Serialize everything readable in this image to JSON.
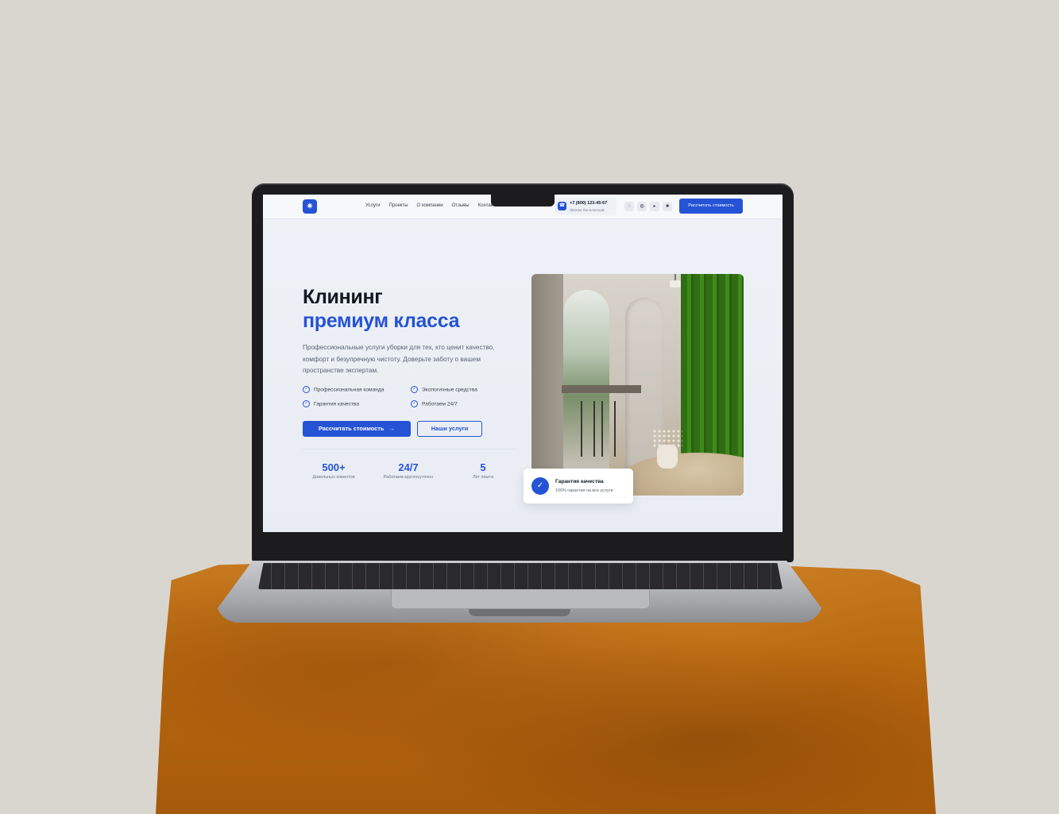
{
  "nav": {
    "logo_glyph": "✷",
    "menu": [
      "Услуги",
      "Проекты",
      "О компании",
      "Отзывы",
      "Контакты"
    ],
    "phone": "+7 (800) 123-45-67",
    "phone_note": "Звонок бесплатный",
    "phone_icon": "phone-icon",
    "socials": [
      "chat-icon",
      "discord-icon",
      "youtube-icon",
      "vk-icon"
    ],
    "cta_label": "Рассчитать стоимость"
  },
  "hero": {
    "title_line1": "Клининг",
    "title_line2": "премиум класса",
    "lead": "Профессиональные услуги уборки для тех, кто ценит качество, комфорт и безупречную чистоту. Доверьте заботу о вашем пространстве экспертам.",
    "features": [
      "Профессиональная команда",
      "Экологичные средства",
      "Гарантия качества",
      "Работаем 24/7"
    ],
    "primary_button": "Рассчитать стоимость",
    "secondary_button": "Наши услуги",
    "stats": [
      {
        "value": "500+",
        "label": "Довольных клиентов"
      },
      {
        "value": "24/7",
        "label": "Работаем круглосуточно"
      },
      {
        "value": "5",
        "label": "Лет опыта"
      }
    ]
  },
  "badge": {
    "title": "Гарантия качества",
    "subtitle": "100% гарантия на все услуги"
  },
  "colors": {
    "accent": "#2553d6",
    "heading": "#121722",
    "pedestal": "#b8680f",
    "background": "#d9d6d0"
  }
}
